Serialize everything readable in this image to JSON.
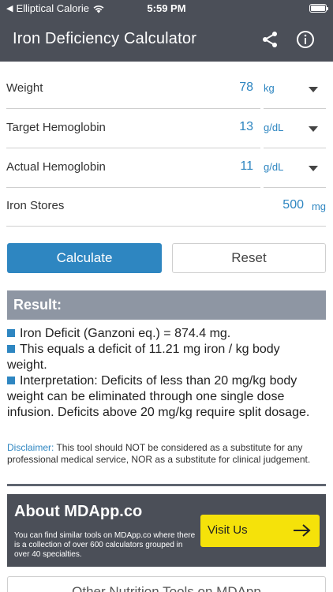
{
  "status_bar": {
    "carrier": "Elliptical Calorie",
    "time": "5:59 PM"
  },
  "app_bar": {
    "title": "Iron Deficiency Calculator",
    "share_icon": "share-icon",
    "info_icon": "info-icon"
  },
  "form": {
    "weight": {
      "label": "Weight",
      "value": "78",
      "unit": "kg"
    },
    "target_hb": {
      "label": "Target Hemoglobin",
      "value": "13",
      "unit": "g/dL"
    },
    "actual_hb": {
      "label": "Actual Hemoglobin",
      "value": "11",
      "unit": "g/dL"
    },
    "iron_stores": {
      "label": "Iron Stores",
      "value": "500",
      "unit": "mg"
    }
  },
  "buttons": {
    "calculate": "Calculate",
    "reset": "Reset"
  },
  "result": {
    "header": "Result:",
    "line1": "Iron Deficit (Ganzoni eq.) = 874.4 mg.",
    "line2": "This equals a deficit of 11.21 mg iron / kg body weight.",
    "line3": "Interpretation: Deficits of less than 20 mg/kg body weight can be eliminated through one single dose infusion. Deficits above 20 mg/kg require split dosage."
  },
  "disclaimer": {
    "tag": "Disclaimer:",
    "text": "This tool should NOT be considered as a substitute for any professional medical service, NOR as a substitute for clinical judgement."
  },
  "about": {
    "title": "About MDApp.co",
    "text": "You can find similar tools on MDApp.co where there is a collection of over 600 calculators grouped in over 40 specialties.",
    "visit_label": "Visit Us"
  },
  "more_tools": {
    "label": "Other Nutrition Tools on MDApp"
  },
  "colors": {
    "header_bg": "#4b4f58",
    "accent": "#2e86c1",
    "result_header_bg": "#8e96a3",
    "visit_button": "#f5e20a"
  }
}
